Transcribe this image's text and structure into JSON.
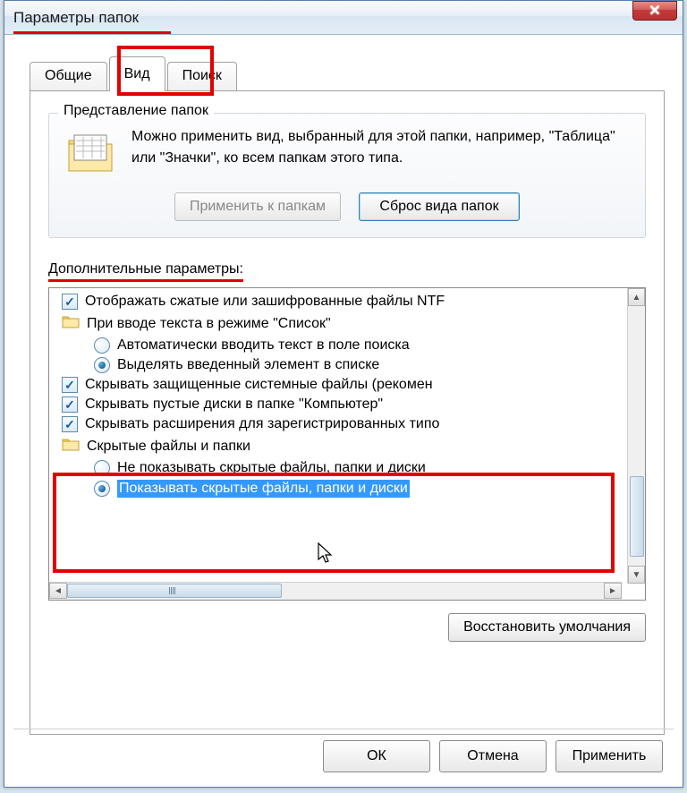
{
  "window": {
    "title": "Параметры папок"
  },
  "tabs": {
    "general": "Общие",
    "view": "Вид",
    "search": "Поиск"
  },
  "groupbox": {
    "legend": "Представление папок",
    "description": "Можно применить вид, выбранный для этой папки, например, \"Таблица\" или \"Значки\", ко всем папкам этого типа.",
    "apply_button": "Применить к папкам",
    "reset_button": "Сброс вида папок"
  },
  "advanced": {
    "label": "Дополнительные параметры:",
    "items": [
      {
        "type": "checkbox",
        "checked": true,
        "indent": 1,
        "text": "Отображать сжатые или зашифрованные файлы NTF"
      },
      {
        "type": "folder",
        "indent": 1,
        "text": "При вводе текста в режиме \"Список\""
      },
      {
        "type": "radio",
        "selected": false,
        "indent": 2,
        "text": "Автоматически вводить текст в поле поиска"
      },
      {
        "type": "radio",
        "selected": true,
        "indent": 2,
        "text": "Выделять введенный элемент в списке"
      },
      {
        "type": "checkbox",
        "checked": true,
        "indent": 1,
        "text": "Скрывать защищенные системные файлы (рекомен"
      },
      {
        "type": "checkbox",
        "checked": true,
        "indent": 1,
        "text": "Скрывать пустые диски в папке \"Компьютер\""
      },
      {
        "type": "checkbox",
        "checked": true,
        "indent": 1,
        "text": "Скрывать расширения для зарегистрированных типо"
      },
      {
        "type": "folder",
        "indent": 1,
        "text": "Скрытые файлы и папки"
      },
      {
        "type": "radio",
        "selected": false,
        "indent": 2,
        "text": "Не показывать скрытые файлы, папки и диски"
      },
      {
        "type": "radio",
        "selected": true,
        "indent": 2,
        "highlighted": true,
        "text": "Показывать скрытые файлы, папки и диски"
      }
    ],
    "restore_button": "Восстановить умолчания"
  },
  "dialog_buttons": {
    "ok": "ОК",
    "cancel": "Отмена",
    "apply": "Применить"
  }
}
